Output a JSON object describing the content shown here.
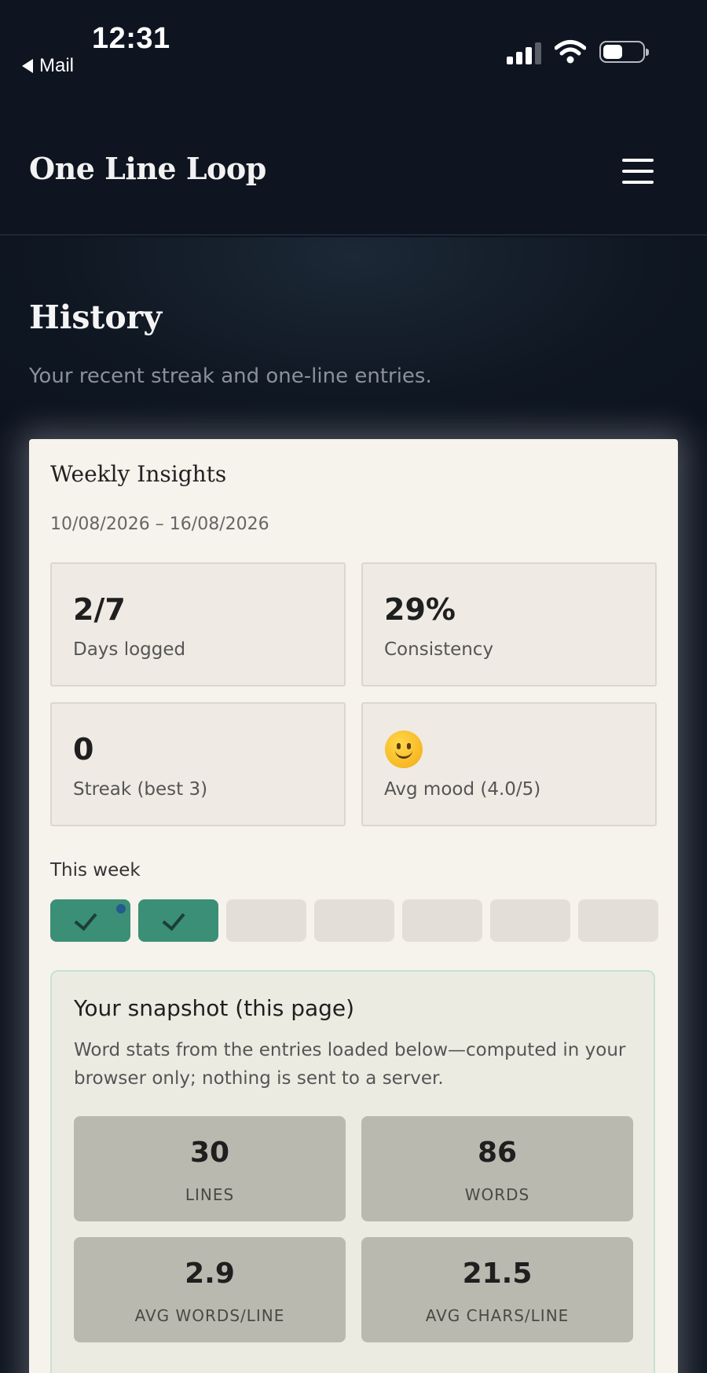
{
  "status_bar": {
    "time": "12:31",
    "back_label": "Mail"
  },
  "header": {
    "brand": "One Line Loop"
  },
  "page": {
    "title": "History",
    "subtitle": "Your recent streak and one-line entries."
  },
  "insights": {
    "title": "Weekly Insights",
    "date_range": "10/08/2026 – 16/08/2026",
    "stats": [
      {
        "value": "2/7",
        "label": "Days logged"
      },
      {
        "value": "29%",
        "label": "Consistency"
      },
      {
        "value": "0",
        "label": "Streak (best 3)"
      },
      {
        "icon": "slightly-smiling-face-icon",
        "label": "Avg mood (4.0/5)"
      }
    ],
    "week_label": "This week",
    "week_days_done": [
      true,
      true,
      false,
      false,
      false,
      false,
      false
    ]
  },
  "snapshot": {
    "title": "Your snapshot (this page)",
    "description": "Word stats from the entries loaded below—computed in your browser only; nothing is sent to a server.",
    "stats": [
      {
        "value": "30",
        "label": "LINES"
      },
      {
        "value": "86",
        "label": "WORDS"
      },
      {
        "value": "2.9",
        "label": "AVG WORDS/LINE"
      },
      {
        "value": "21.5",
        "label": "AVG CHARS/LINE"
      }
    ]
  },
  "colors": {
    "background": "#0e1420",
    "card": "#f6f2ec",
    "done_day": "#3a8f76"
  }
}
